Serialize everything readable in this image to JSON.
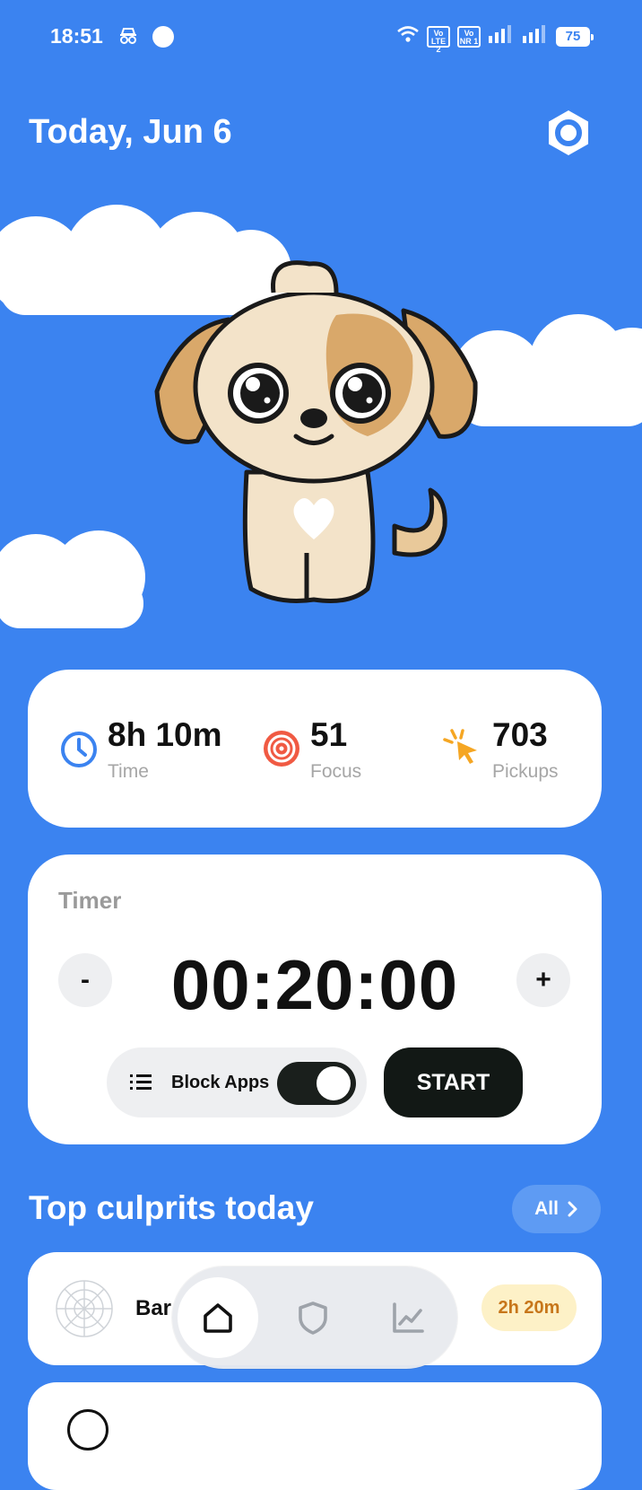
{
  "status_bar": {
    "time": "18:51",
    "sim1": "Vo LTE 2",
    "sim2": "Vo NR 1",
    "battery": "75"
  },
  "header": {
    "date": "Today, Jun 6"
  },
  "stats": [
    {
      "icon": "clock-icon",
      "value": "8h 10m",
      "label": "Time",
      "color": "#3b83f0"
    },
    {
      "icon": "target-icon",
      "value": "51",
      "label": "Focus",
      "color": "#f05a43"
    },
    {
      "icon": "tap-icon",
      "value": "703",
      "label": "Pickups",
      "color": "#f5a623"
    }
  ],
  "timer": {
    "label": "Timer",
    "value": "00:20:00",
    "minus": "-",
    "plus": "+",
    "block_apps_label": "Block Apps",
    "block_apps_enabled": true,
    "start_label": "START"
  },
  "culprits": {
    "title": "Top culprits today",
    "all_label": "All",
    "items": [
      {
        "name": "Bar",
        "time": "2h 20m"
      }
    ]
  },
  "nav": [
    "home-icon",
    "shield-icon",
    "chart-icon"
  ],
  "colors": {
    "background": "#3b83f0",
    "card": "#ffffff",
    "accent_dark": "#121815"
  }
}
